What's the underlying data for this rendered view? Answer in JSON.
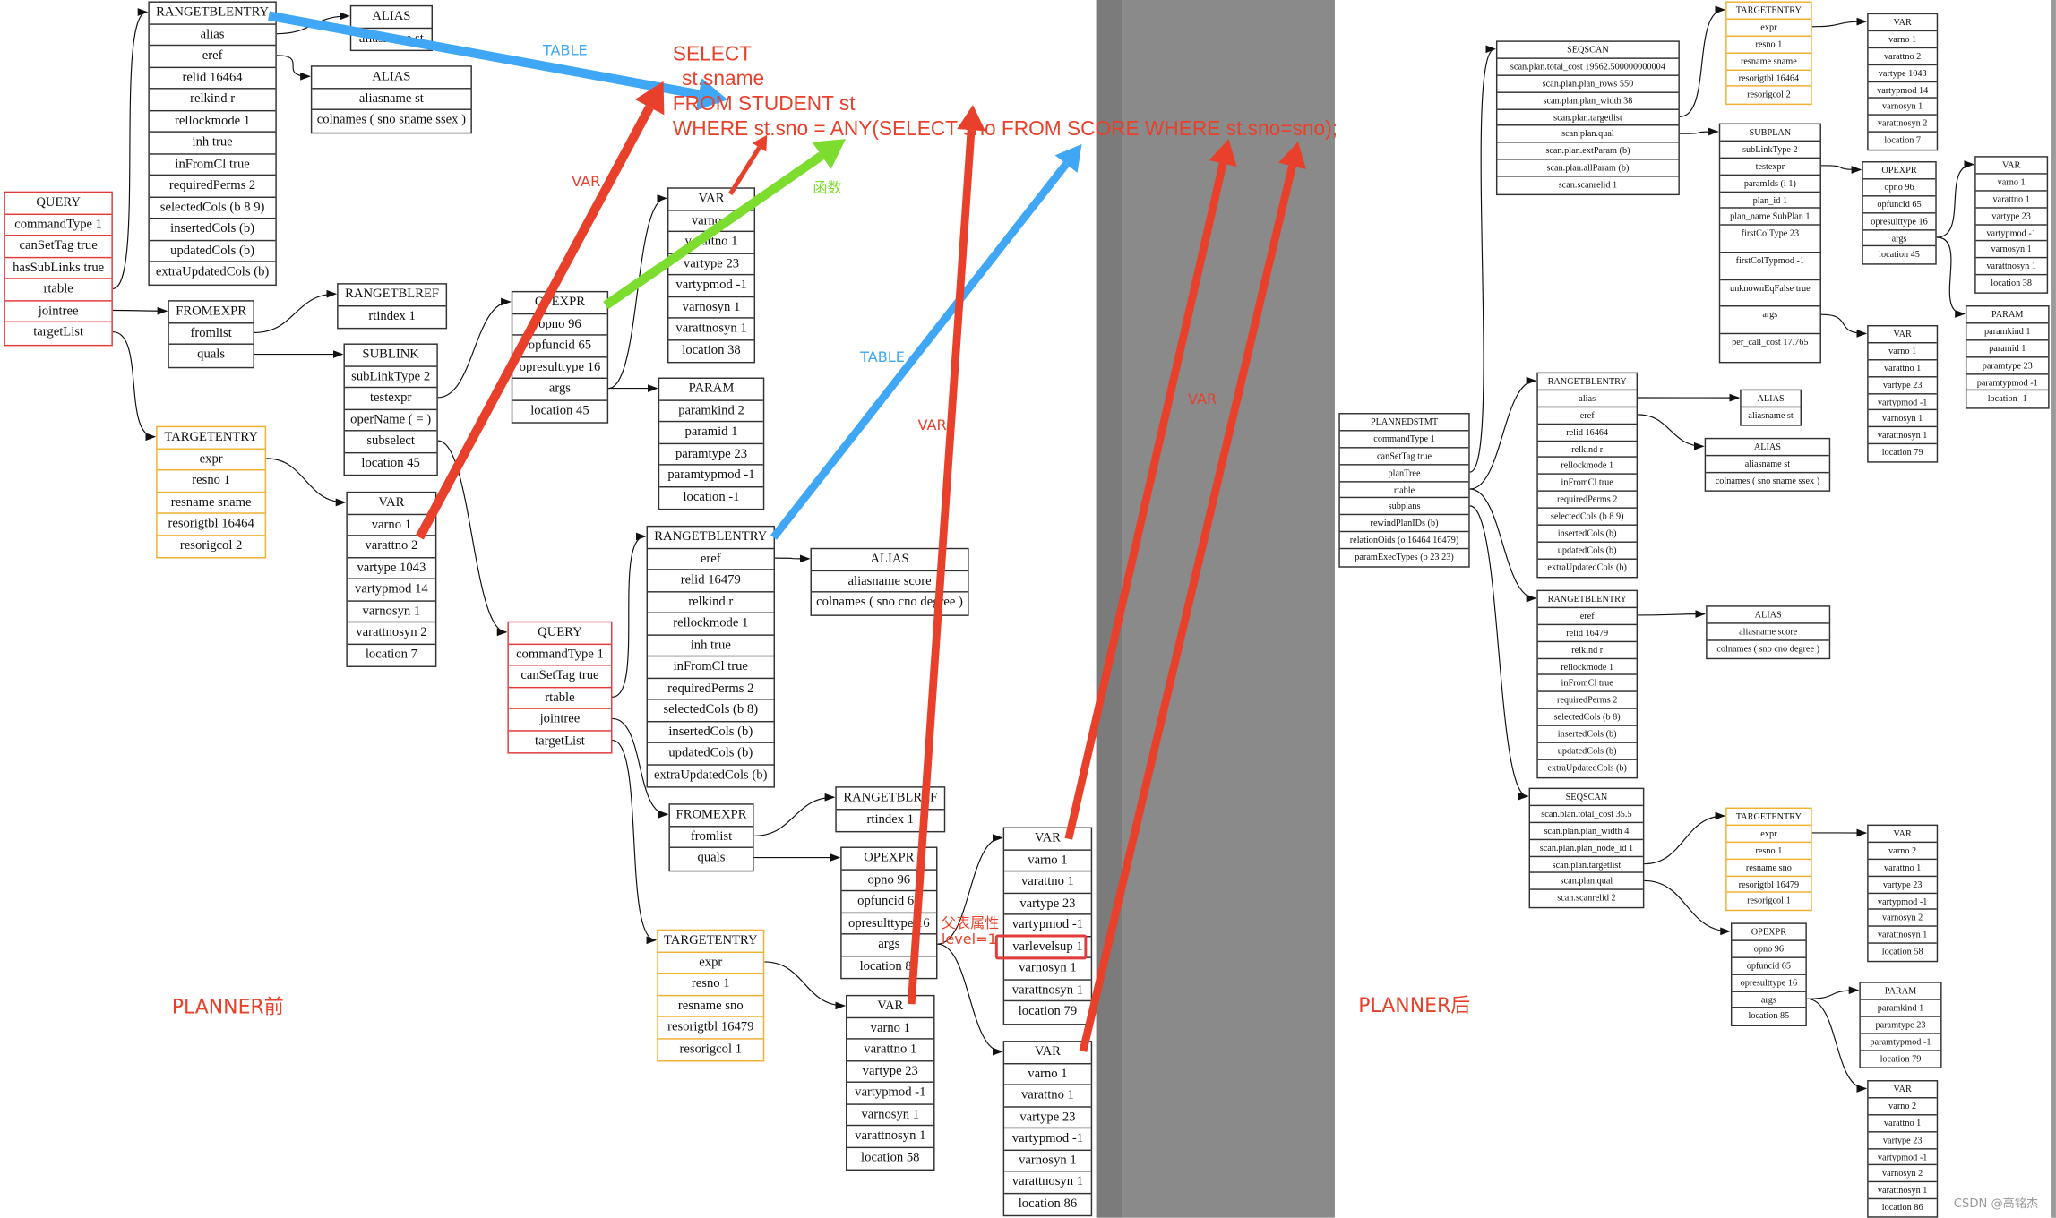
{
  "sql": {
    "lines": [
      "SELECT",
      "st.sname",
      "FROM STUDENT st",
      "WHERE st.sno = ANY(SELECT sno FROM SCORE WHERE st.sno=sno);"
    ]
  },
  "labels": {
    "table_1": "TABLE",
    "var_1": "VAR",
    "func": "函数",
    "table_2": "TABLE",
    "var_2": "VAR",
    "var_3": "VAR",
    "parent_attr": "父表属性",
    "level": "level=1",
    "planner_before": "PLANNER前",
    "planner_after": "PLANNER后",
    "watermark": "CSDN @高铭杰"
  },
  "colors": {
    "table_arrow": "#3fa7f5",
    "var_arrow": "#e8402a",
    "func_arrow": "#7ddd2e",
    "query_border": "#e23b3b",
    "targetentry_border": "#f0b030"
  },
  "diagram": {
    "nodes": [
      {
        "title": "RANGETBLENTRY",
        "rows": [
          "alias",
          "eref",
          "relid 16464",
          "relkind r",
          "rellockmode 1",
          "inh true",
          "inFromCl true",
          "requiredPerms 2",
          "selectedCols (b 8 9)",
          "insertedCols (b)",
          "updatedCols (b)",
          "extraUpdatedCols (b)"
        ]
      },
      {
        "title": "ALIAS",
        "rows": [
          "aliasname st"
        ]
      },
      {
        "title": "ALIAS",
        "rows": [
          "aliasname st",
          "colnames ( sno sname ssex )"
        ]
      },
      {
        "title": "QUERY",
        "style": "red",
        "rows": [
          "commandType 1",
          "canSetTag true",
          "hasSubLinks true",
          "rtable",
          "jointree",
          "targetList"
        ]
      },
      {
        "title": "FROMEXPR",
        "rows": [
          "fromlist",
          "quals"
        ]
      },
      {
        "title": "RANGETBLREF",
        "rows": [
          "rtindex 1"
        ]
      },
      {
        "title": "SUBLINK",
        "rows": [
          "subLinkType 2",
          "testexpr",
          "operName ( = )",
          "subselect",
          "location 45"
        ]
      },
      {
        "title": "TARGETENTRY",
        "style": "orange",
        "rows": [
          "expr",
          "resno 1",
          "resname sname",
          "resorigtbl 16464",
          "resorigcol 2"
        ]
      },
      {
        "title": "VAR",
        "rows": [
          "varno 1",
          "varattno 2",
          "vartype 1043",
          "vartypmod 14",
          "varnosyn 1",
          "varattnosyn 2",
          "location 7"
        ]
      },
      {
        "title": "OPEXPR",
        "rows": [
          "opno 96",
          "opfuncid 65",
          "opresulttype 16",
          "args",
          "location 45"
        ]
      },
      {
        "title": "VAR",
        "rows": [
          "varno 1",
          "varattno 1",
          "vartype 23",
          "vartypmod -1",
          "varnosyn 1",
          "varattnosyn 1",
          "location 38"
        ]
      },
      {
        "title": "PARAM",
        "rows": [
          "paramkind 2",
          "paramid 1",
          "paramtype 23",
          "paramtypmod -1",
          "location -1"
        ]
      },
      {
        "title": "RANGETBLENTRY",
        "rows": [
          "eref",
          "relid 16479",
          "relkind r",
          "rellockmode 1",
          "inh true",
          "inFromCl true",
          "requiredPerms 2",
          "selectedCols (b 8)",
          "insertedCols (b)",
          "updatedCols (b)",
          "extraUpdatedCols (b)"
        ]
      },
      {
        "title": "ALIAS",
        "rows": [
          "aliasname score",
          "colnames ( sno cno degree )"
        ]
      },
      {
        "title": "QUERY",
        "style": "red",
        "rows": [
          "commandType 1",
          "canSetTag true",
          "rtable",
          "jointree",
          "targetList"
        ]
      },
      {
        "title": "FROMEXPR",
        "rows": [
          "fromlist",
          "quals"
        ]
      },
      {
        "title": "RANGETBLREF",
        "rows": [
          "rtindex 1"
        ]
      },
      {
        "title": "OPEXPR",
        "rows": [
          "opno 96",
          "opfuncid 65",
          "opresulttype 16",
          "args",
          "location 85"
        ]
      },
      {
        "title": "TARGETENTRY",
        "style": "orange",
        "rows": [
          "expr",
          "resno 1",
          "resname sno",
          "resorigtbl 16479",
          "resorigcol 1"
        ]
      },
      {
        "title": "VAR",
        "rows": [
          "varno 1",
          "varattno 1",
          "vartype 23",
          "vartypmod -1",
          "varnosyn 1",
          "varattnosyn 1",
          "location 58"
        ]
      },
      {
        "title": "VAR",
        "rows": [
          "varno 1",
          "varattno 1",
          "vartype 23",
          "vartypmod -1",
          "varlevelsup 1",
          "varnosyn 1",
          "varattnosyn 1",
          "location 79"
        ]
      },
      {
        "title": "VAR",
        "rows": [
          "varno 1",
          "varattno 1",
          "vartype 23",
          "vartypmod -1",
          "varnosyn 1",
          "varattnosyn 1",
          "location 86"
        ]
      },
      {
        "title": "PLANNEDSTMT",
        "rows": [
          "commandType 1",
          "canSetTag true",
          "planTree",
          "rtable",
          "subplans",
          "rewindPlanIDs (b)",
          "relationOids (o 16464 16479)",
          "paramExecTypes (o 23 23)"
        ]
      },
      {
        "title": "SEQSCAN",
        "rows": [
          "scan.plan.total_cost 19562.500000000004",
          "scan.plan.plan_rows 550",
          "scan.plan.plan_width 38",
          "scan.plan.targetlist",
          "scan.plan.qual",
          "scan.plan.extParam (b)",
          "scan.plan.allParam (b)",
          "scan.scanrelid 1"
        ]
      },
      {
        "title": "TARGETENTRY",
        "style": "orange",
        "rows": [
          "expr",
          "resno 1",
          "resname sname",
          "resorigtbl 16464",
          "resorigcol 2"
        ]
      },
      {
        "title": "VAR",
        "rows": [
          "varno 1",
          "varattno 2",
          "vartype 1043",
          "vartypmod 14",
          "varnosyn 1",
          "varattnosyn 2",
          "location 7"
        ]
      },
      {
        "title": "SUBPLAN",
        "rows": [
          "subLinkType 2",
          "testexpr",
          "paramIds (i 1)",
          "plan_id 1",
          "plan_name SubPlan 1",
          "firstColType 23",
          "firstColTypmod -1",
          "unknownEqFalse true",
          "args",
          "per_call_cost 17.765"
        ]
      },
      {
        "title": "OPEXPR",
        "rows": [
          "opno 96",
          "opfuncid 65",
          "opresulttype 16",
          "args",
          "location 45"
        ]
      },
      {
        "title": "VAR",
        "rows": [
          "varno 1",
          "varattno 1",
          "vartype 23",
          "vartypmod -1",
          "varnosyn 1",
          "varattnosyn 1",
          "location 38"
        ]
      },
      {
        "title": "PARAM",
        "rows": [
          "paramkind 1",
          "paramid 1",
          "paramtype 23",
          "paramtypmod -1",
          "location -1"
        ]
      },
      {
        "title": "VAR",
        "rows": [
          "varno 1",
          "varattno 1",
          "vartype 23",
          "vartypmod -1",
          "varnosyn 1",
          "varattnosyn 1",
          "location 79"
        ]
      },
      {
        "title": "RANGETBLENTRY",
        "rows": [
          "alias",
          "eref",
          "relid 16464",
          "relkind r",
          "rellockmode 1",
          "inFromCl true",
          "requiredPerms 2",
          "selectedCols (b 8 9)",
          "insertedCols (b)",
          "updatedCols (b)",
          "extraUpdatedCols (b)"
        ]
      },
      {
        "title": "ALIAS",
        "rows": [
          "aliasname st"
        ]
      },
      {
        "title": "ALIAS",
        "rows": [
          "aliasname st",
          "colnames ( sno sname ssex )"
        ]
      },
      {
        "title": "RANGETBLENTRY",
        "rows": [
          "eref",
          "relid 16479",
          "relkind r",
          "rellockmode 1",
          "inFromCl true",
          "requiredPerms 2",
          "selectedCols (b 8)",
          "insertedCols (b)",
          "updatedCols (b)",
          "extraUpdatedCols (b)"
        ]
      },
      {
        "title": "ALIAS",
        "rows": [
          "aliasname score",
          "colnames ( sno cno degree )"
        ]
      },
      {
        "title": "SEQSCAN",
        "rows": [
          "scan.plan.total_cost 35.5",
          "scan.plan.plan_width 4",
          "scan.plan.plan_node_id 1",
          "scan.plan.targetlist",
          "scan.plan.qual",
          "scan.scanrelid 2"
        ]
      },
      {
        "title": "TARGETENTRY",
        "style": "orange",
        "rows": [
          "expr",
          "resno 1",
          "resname sno",
          "resorigtbl 16479",
          "resorigcol 1"
        ]
      },
      {
        "title": "VAR",
        "rows": [
          "varno 2",
          "varattno 1",
          "vartype 23",
          "vartypmod -1",
          "varnosyn 2",
          "varattnosyn 1",
          "location 58"
        ]
      },
      {
        "title": "OPEXPR",
        "rows": [
          "opno 96",
          "opfuncid 65",
          "opresulttype 16",
          "args",
          "location 85"
        ]
      },
      {
        "title": "PARAM",
        "rows": [
          "paramkind 1",
          "paramtype 23",
          "paramtypmod -1",
          "location 79"
        ]
      },
      {
        "title": "VAR",
        "rows": [
          "varno 2",
          "varattno 1",
          "vartype 23",
          "vartypmod -1",
          "varnosyn 2",
          "varattnosyn 1",
          "location 86"
        ]
      }
    ]
  }
}
